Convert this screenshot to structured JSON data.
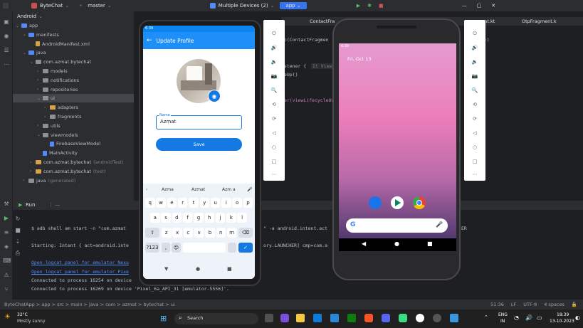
{
  "titlebar": {
    "project": "ByteChat",
    "branch": "master",
    "devices": "Multiple Devices (2)",
    "run_config": "app"
  },
  "project_panel": {
    "header": "Android",
    "tree": [
      {
        "label": "app",
        "indent": 0,
        "type": "folder-blue",
        "arrow": "⌄"
      },
      {
        "label": "manifests",
        "indent": 1,
        "type": "folder-blue",
        "arrow": "⌄"
      },
      {
        "label": "AndroidManifest.xml",
        "indent": 2,
        "type": "file-orange",
        "arrow": ""
      },
      {
        "label": "java",
        "indent": 1,
        "type": "folder-blue",
        "arrow": "⌄"
      },
      {
        "label": "com.azmat.bytechat",
        "indent": 2,
        "type": "folder-gray",
        "arrow": "⌄"
      },
      {
        "label": "models",
        "indent": 3,
        "type": "folder-gray",
        "arrow": "›"
      },
      {
        "label": "notifications",
        "indent": 3,
        "type": "folder-gray",
        "arrow": "›"
      },
      {
        "label": "repositories",
        "indent": 3,
        "type": "folder-gray",
        "arrow": "›"
      },
      {
        "label": "ui",
        "indent": 3,
        "type": "folder-gray",
        "arrow": "⌄",
        "selected": true
      },
      {
        "label": "adapters",
        "indent": 4,
        "type": "folder-orange",
        "arrow": "›"
      },
      {
        "label": "fragments",
        "indent": 4,
        "type": "folder-gray",
        "arrow": "›"
      },
      {
        "label": "utils",
        "indent": 3,
        "type": "folder-gray",
        "arrow": "›"
      },
      {
        "label": "viewmodels",
        "indent": 3,
        "type": "folder-gray",
        "arrow": "⌄"
      },
      {
        "label": "FirebaseViewModel",
        "indent": 4,
        "type": "file-blue",
        "arrow": ""
      },
      {
        "label": "MainActivity",
        "indent": 3,
        "type": "file-blue",
        "arrow": ""
      },
      {
        "label": "com.azmat.bytechat",
        "suffix": "(androidTest)",
        "indent": 2,
        "type": "folder-orange",
        "arrow": "›"
      },
      {
        "label": "com.azmat.bytechat",
        "suffix": "(test)",
        "indent": 2,
        "type": "folder-orange",
        "arrow": "›"
      },
      {
        "label": "java",
        "suffix": "(generated)",
        "indent": 1,
        "type": "folder-gray",
        "arrow": "›"
      }
    ]
  },
  "editor": {
    "tabs": [
      "ContactFra",
      "...ragment.kt",
      "OtpFragment.k"
    ],
    "code_lines": [
      "(it))",
      "tc(ContactFragmen",
      "istener {",
      "It View",
      "reUp()",
      "ner(viewLifecycleOwner,"
    ]
  },
  "run_panel": {
    "tab_label": "Run",
    "lines": [
      {
        "text": "$ adb shell am start -n \"com.azmat",
        "color": "#bcbec4"
      },
      {
        "text": "Starting: Intent { act=android.inte",
        "color": "#bcbec4"
      },
      {
        "text": "Open logcat panel for emulator Nexu",
        "color": "#548af7",
        "underline": true
      },
      {
        "text": "Open logcat panel for emulator Pixe",
        "color": "#548af7",
        "underline": true
      },
      {
        "text": "Connected to process 16254 on device",
        "color": "#bcbec4"
      },
      {
        "text": "Connected to process 16269 on device 'Pixel_6a_API_31 [emulator-5556]'.",
        "color": "#bcbec4"
      }
    ],
    "right_fragment_1": "\" -a android.intent.act",
    "right_fragment_2": "ory.LAUNCHER] cmp=com.a",
    "right_fragment_3": "ER"
  },
  "statusbar": {
    "breadcrumb": "ByteChatApp > app > src > main > java > com > azmat > bytechat > ui",
    "position": "51:36",
    "line_sep": "LF",
    "encoding": "UTF-8",
    "indent": "4 spaces"
  },
  "taskbar": {
    "weather_temp": "32°C",
    "weather_desc": "Mostly sunny",
    "search_label": "Search",
    "lang": "ENG",
    "region": "IN",
    "time": "18:39",
    "date": "13-10-2023"
  },
  "phone1": {
    "status_time": "6:39",
    "appbar_title": "Update Profile",
    "field_label": "Name",
    "field_value": "Azmat",
    "save_label": "Save",
    "suggestions": [
      "Azma",
      "Azmat",
      "Azm a"
    ],
    "row1": [
      "q",
      "w",
      "e",
      "r",
      "t",
      "y",
      "u",
      "i",
      "o",
      "p"
    ],
    "row2": [
      "a",
      "s",
      "d",
      "f",
      "g",
      "h",
      "j",
      "k",
      "l"
    ],
    "row3": [
      "z",
      "x",
      "c",
      "v",
      "b",
      "n",
      "m"
    ],
    "symbols_key": "?123",
    "comma_key": ","
  },
  "phone2": {
    "status_time": "6:39",
    "date_text": "Fri, Oct 13"
  },
  "colors": {
    "ide_bg": "#1e1f22",
    "panel_bg": "#2b2d30",
    "accent": "#1479e2",
    "link": "#548af7"
  }
}
